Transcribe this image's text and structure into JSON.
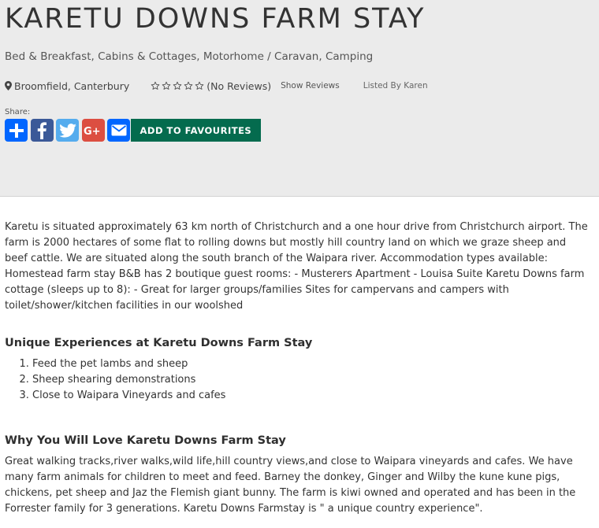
{
  "listing": {
    "title": "KARETU DOWNS FARM STAY",
    "categories": "Bed & Breakfast, Cabins & Cottages, Motorhome / Caravan, Camping",
    "location": "Broomfield, Canterbury",
    "rating": {
      "stars": 0,
      "max": 5,
      "reviews_text": "(No Reviews)"
    },
    "show_reviews": "Show Reviews",
    "listed_by": "Listed By Karen"
  },
  "share": {
    "label": "Share:",
    "buttons": [
      {
        "name": "add-share-button",
        "icon": "plus-icon",
        "color": "#0166ff"
      },
      {
        "name": "facebook-share-button",
        "icon": "facebook-icon",
        "color": "#3b5998"
      },
      {
        "name": "twitter-share-button",
        "icon": "twitter-icon",
        "color": "#55acee"
      },
      {
        "name": "google-plus-share-button",
        "icon": "google-plus-icon",
        "color": "#dc4e41"
      },
      {
        "name": "email-share-button",
        "icon": "envelope-icon",
        "color": "#0166ff"
      }
    ],
    "favourites_label": "ADD TO FAVOURITES",
    "favourites_color": "#046b4e"
  },
  "content": {
    "description": "Karetu is situated approximately 63 km north of Christchurch and a one hour drive from Christchurch airport. The farm is 2000 hectares of some flat to rolling downs but mostly hill country land on which we graze sheep and beef cattle. We are situated along the south branch of the Waipara river. Accommodation types available: Homestead farm stay B&B has 2 boutique guest rooms: - Musterers Apartment - Louisa Suite Karetu Downs farm cottage (sleeps up to 8): - Great for larger groups/families Sites for campervans and campers with toilet/shower/kitchen facilities in our woolshed",
    "experiences_heading": "Unique Experiences at Karetu Downs Farm Stay",
    "experiences": [
      "Feed the pet lambs and sheep",
      "Sheep shearing demonstrations",
      "Close to Waipara Vineyards and cafes"
    ],
    "love_heading": "Why You Will Love Karetu Downs Farm Stay",
    "love_text": "Great walking tracks,river walks,wild life,hill country views,and close to Waipara vineyards and cafes. We have many farm animals for children to meet and feed. Barney the donkey, Ginger and Wilby the kune kune pigs, chickens, pet sheep and Jaz the Flemish giant bunny. The farm is kiwi owned and operated and has been in the Forrester family for 3 generations. Karetu Downs Farmstay is \" a unique country experience\"."
  }
}
